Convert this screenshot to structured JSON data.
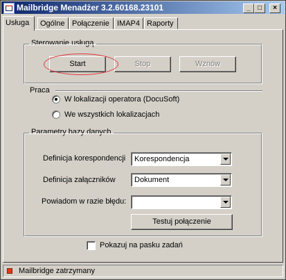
{
  "window": {
    "title": "Mailbridge Menadżer 3.2.60168.23101",
    "controls": [
      "_",
      "□",
      "×"
    ]
  },
  "tabs": [
    {
      "label": "Usługa",
      "active": true
    },
    {
      "label": "Ogólne",
      "active": false
    },
    {
      "label": "Połączenie",
      "active": false
    },
    {
      "label": "IMAP4",
      "active": false
    },
    {
      "label": "Raporty",
      "active": false
    }
  ],
  "service_control": {
    "legend": "Sterowanie usługą",
    "start_label": "Start",
    "stop_label": "Stop",
    "resume_label": "Wznów"
  },
  "work": {
    "legend": "Praca",
    "option_operator": "W lokalizacji operatora (DocuSoft)",
    "option_all": "We wszystkich lokalizacjach",
    "selected": "option_operator"
  },
  "db_params": {
    "legend": "Parametry bazy danych",
    "correspondence_label": "Definicja korespondencji",
    "correspondence_value": "Korespondencja",
    "attachments_label": "Definicja załączników",
    "attachments_value": "Dokument",
    "error_notify_label": "Powiadom w razie błędu:",
    "error_notify_value": "",
    "test_button": "Testuj połączenie"
  },
  "taskbar_checkbox": {
    "label": "Pokazuj na pasku zadań",
    "checked": false
  },
  "status": {
    "text": "Mailbridge zatrzymany",
    "color": "#e03a1a"
  },
  "colors": {
    "titlebar_start": "#0a246a",
    "titlebar_end": "#a6caf0",
    "highlight": "#e0393e"
  }
}
